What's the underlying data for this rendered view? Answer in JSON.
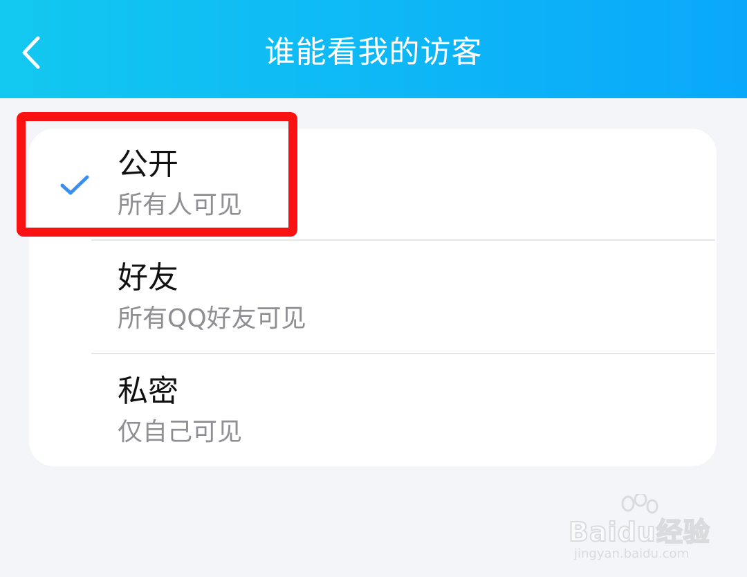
{
  "header": {
    "title": "谁能看我的访客",
    "back_icon": "chevron-left-icon",
    "gradient_start": "#12c8f0",
    "gradient_end": "#0aa8fb"
  },
  "options": [
    {
      "name": "公开",
      "desc": "所有人可见",
      "selected": true
    },
    {
      "name": "好友",
      "desc": "所有QQ好友可见",
      "selected": false
    },
    {
      "name": "私密",
      "desc": "仅自己可见",
      "selected": false
    }
  ],
  "check_color": "#3a8ef0",
  "annotation": {
    "color": "#fa1212"
  },
  "watermark": {
    "brand": "Baidu经验",
    "url": "jingyan.baidu.com"
  }
}
